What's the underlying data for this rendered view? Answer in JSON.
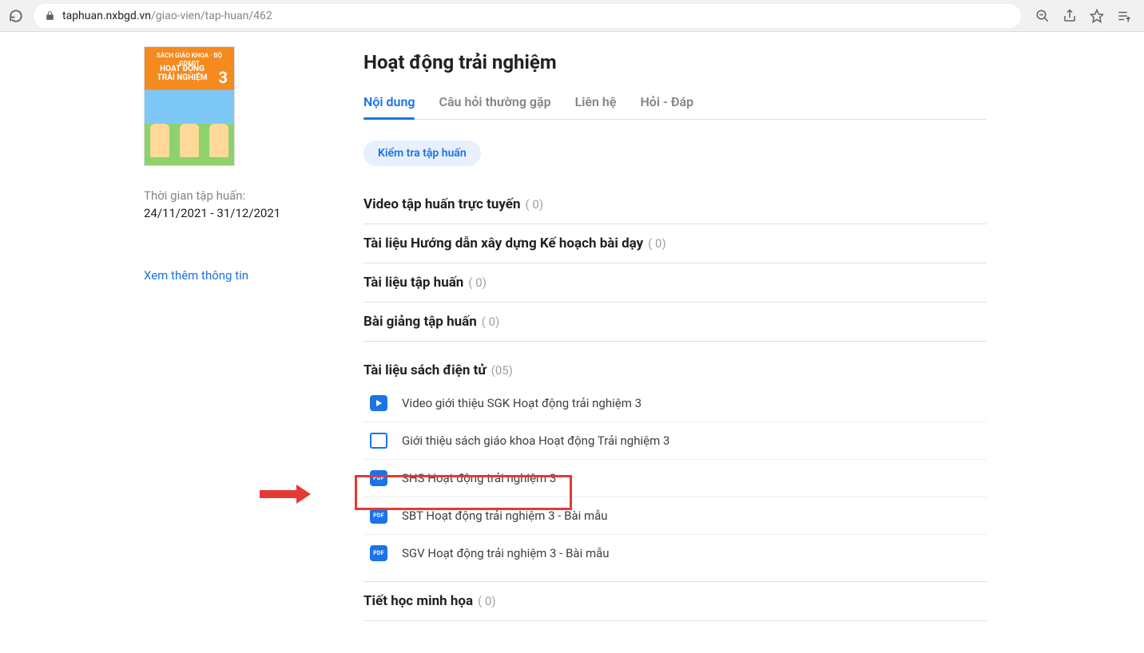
{
  "browser": {
    "url_host": "taphuan.nxbgd.vn",
    "url_path": "/giao-vien/tap-huan/462"
  },
  "sidebar": {
    "cover_subject": "HOẠT ĐỘNG TRẢI NGHIỆM",
    "cover_grade": "3",
    "time_label": "Thời gian tập huấn:",
    "time_value": "24/11/2021 - 31/12/2021",
    "more_link": "Xem thêm thông tin"
  },
  "page_title": "Hoạt động trải nghiệm",
  "tabs": [
    {
      "label": "Nội dung",
      "active": true
    },
    {
      "label": "Câu hỏi thường gặp",
      "active": false
    },
    {
      "label": "Liên hệ",
      "active": false
    },
    {
      "label": "Hỏi - Đáp",
      "active": false
    }
  ],
  "pill": "Kiểm tra tập huấn",
  "sections": [
    {
      "title": "Video tập huấn trực tuyến",
      "count": "( 0)"
    },
    {
      "title": "Tài liệu Hướng dẫn xây dựng Kế hoạch bài dạy",
      "count": "( 0)"
    },
    {
      "title": "Tài liệu tập huấn",
      "count": "( 0)"
    },
    {
      "title": "Bài giảng tập huấn",
      "count": "( 0)"
    }
  ],
  "ebook_section": {
    "title": "Tài liệu sách điện tử",
    "count": "(05)",
    "items": [
      {
        "icon": "video",
        "label": "Video giới thiệu SGK Hoạt động trải nghiệm 3"
      },
      {
        "icon": "slide",
        "label": "Giới thiệu sách giáo khoa Hoạt động Trải nghiệm 3"
      },
      {
        "icon": "pdf",
        "label": "SHS Hoạt động trải nghiệm 3"
      },
      {
        "icon": "pdf",
        "label": "SBT Hoạt động trải nghiệm 3 - Bài mẫu"
      },
      {
        "icon": "pdf",
        "label": "SGV Hoạt động trải nghiệm 3 - Bài mẫu"
      }
    ]
  },
  "last_section": {
    "title": "Tiết học minh họa",
    "count": "( 0)"
  },
  "pdf_badge": "PDF"
}
